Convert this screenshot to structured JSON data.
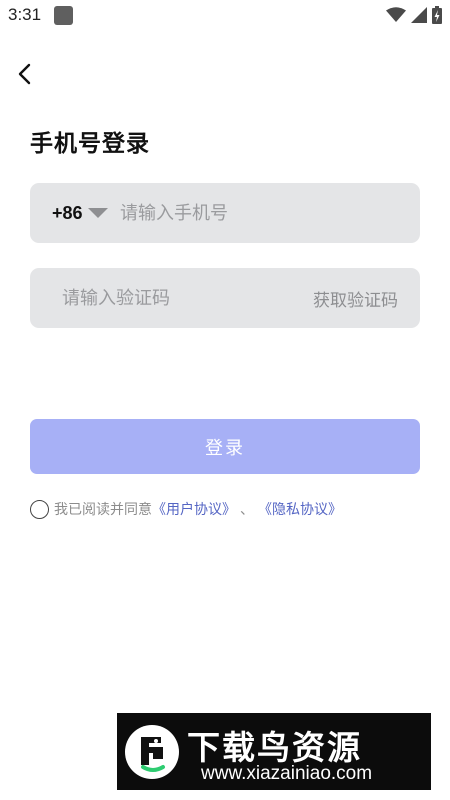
{
  "status_bar": {
    "time": "3:31",
    "icons": [
      "app-notification-icon",
      "wifi-icon",
      "cellular-signal-icon",
      "battery-charging-icon"
    ]
  },
  "header": {
    "back_icon": "chevron-left-icon",
    "title": "手机号登录"
  },
  "phone_field": {
    "country_code": "+86",
    "placeholder": "请输入手机号",
    "value": ""
  },
  "code_field": {
    "placeholder": "请输入验证码",
    "value": "",
    "get_code_label": "获取验证码"
  },
  "login_button": {
    "label": "登录",
    "color": "#a7b0f6"
  },
  "agreement": {
    "checked": false,
    "prefix": "我已阅读并同意",
    "user_agreement": "《用户协议》",
    "separator": "、",
    "privacy_policy": "《隐私协议》",
    "link_color": "#5566c4"
  },
  "watermark": {
    "title": "下载鸟资源",
    "url": "www.xiazainiao.com"
  }
}
